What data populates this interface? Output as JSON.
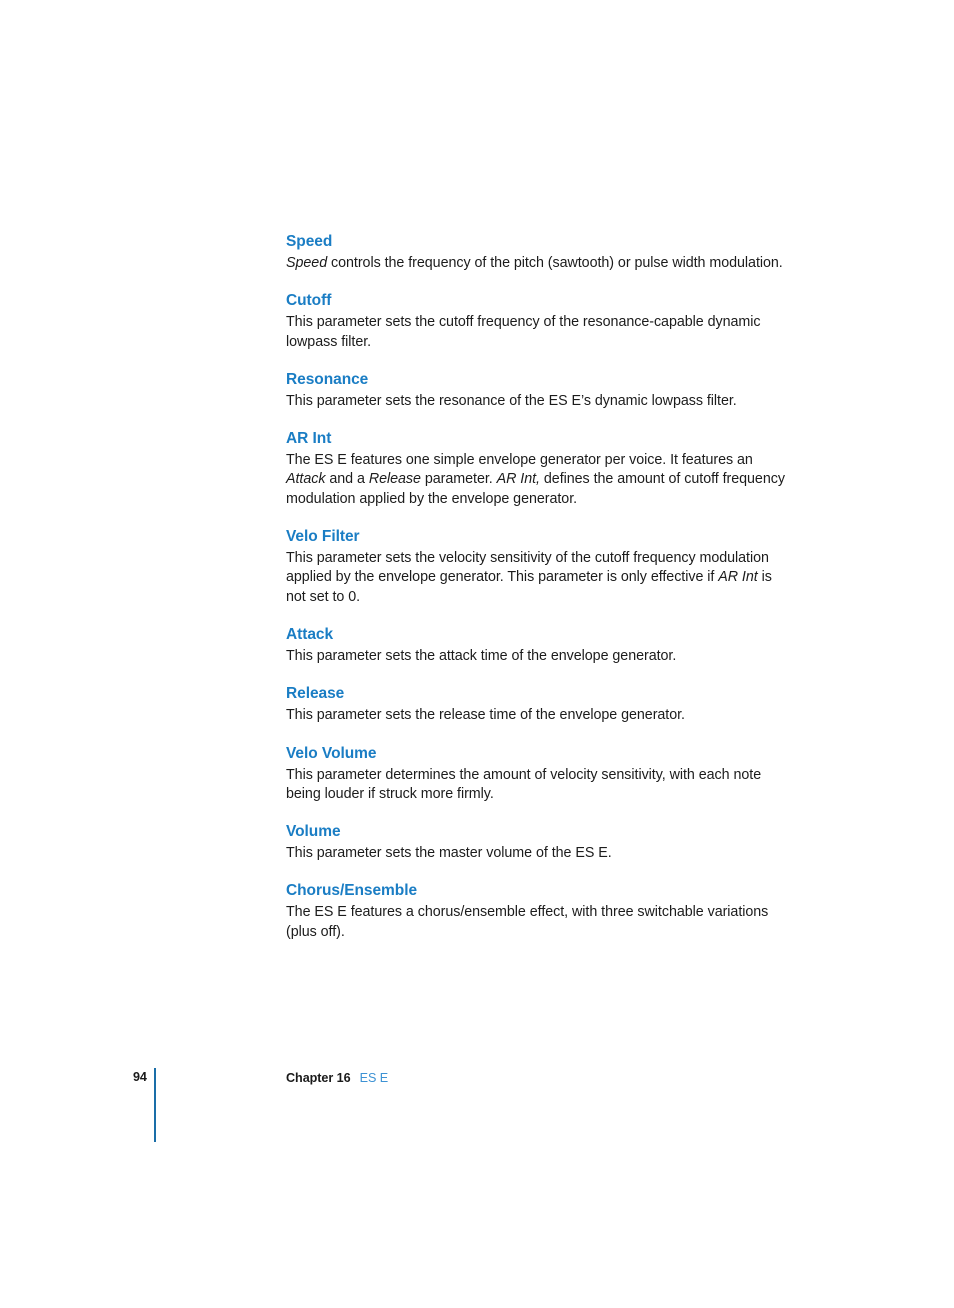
{
  "document": {
    "page_number": "94",
    "chapter_label": "Chapter 16",
    "chapter_title": "ES E"
  },
  "colors": {
    "heading_blue": "#1a7dc4",
    "rule_blue": "#1a6ea8",
    "footer_link_blue": "#3d92d4",
    "body_text": "#1c1c1c",
    "page_background": "#ffffff"
  },
  "sections": [
    {
      "heading": "Speed",
      "body_runs": [
        {
          "text": "Speed",
          "style": "italic"
        },
        {
          "text": " controls the frequency of the pitch (sawtooth) or pulse width modulation.",
          "style": "normal"
        }
      ]
    },
    {
      "heading": "Cutoff",
      "body_runs": [
        {
          "text": "This parameter sets the cutoff frequency of the resonance-capable dynamic lowpass filter.",
          "style": "normal"
        }
      ]
    },
    {
      "heading": "Resonance",
      "body_runs": [
        {
          "text": "This parameter sets the resonance of the ES E’s dynamic lowpass filter.",
          "style": "normal"
        }
      ]
    },
    {
      "heading": "AR Int",
      "body_runs": [
        {
          "text": "The ES E features one simple envelope generator per voice. It features an ",
          "style": "normal"
        },
        {
          "text": "Attack",
          "style": "italic"
        },
        {
          "text": " and a ",
          "style": "normal"
        },
        {
          "text": "Release",
          "style": "italic"
        },
        {
          "text": " parameter. ",
          "style": "normal"
        },
        {
          "text": "AR Int,",
          "style": "italic"
        },
        {
          "text": " defines the amount of cutoff frequency modulation applied by the envelope generator.",
          "style": "normal"
        }
      ]
    },
    {
      "heading": "Velo Filter",
      "body_runs": [
        {
          "text": "This parameter sets the velocity sensitivity of the cutoff frequency modulation applied by the envelope generator. This parameter is only effective if ",
          "style": "normal"
        },
        {
          "text": "AR Int",
          "style": "italic"
        },
        {
          "text": " is not set to 0.",
          "style": "normal"
        }
      ]
    },
    {
      "heading": "Attack",
      "body_runs": [
        {
          "text": "This parameter sets the attack time of the envelope generator.",
          "style": "normal"
        }
      ]
    },
    {
      "heading": "Release",
      "body_runs": [
        {
          "text": "This parameter sets the release time of the envelope generator.",
          "style": "normal"
        }
      ]
    },
    {
      "heading": "Velo Volume",
      "body_runs": [
        {
          "text": "This parameter determines the amount of velocity sensitivity, with each note being louder if struck more firmly.",
          "style": "normal"
        }
      ]
    },
    {
      "heading": "Volume",
      "body_runs": [
        {
          "text": "This parameter sets the master volume of the ES E.",
          "style": "normal"
        }
      ]
    },
    {
      "heading": "Chorus/Ensemble",
      "body_runs": [
        {
          "text": "The ES E features a chorus/ensemble effect, with three switchable variations (plus off).",
          "style": "normal"
        }
      ]
    }
  ]
}
